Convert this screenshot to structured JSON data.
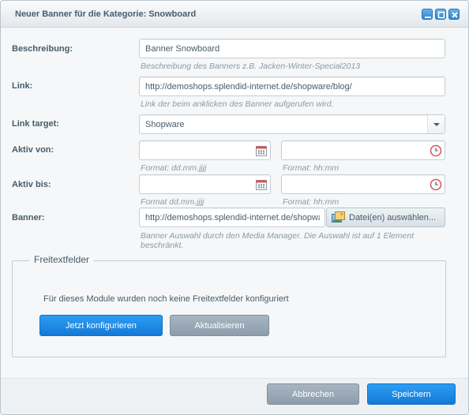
{
  "window": {
    "title": "Neuer Banner für die Kategorie: Snowboard",
    "controls": {
      "minimize": "minimize-icon",
      "maximize": "maximize-icon",
      "close": "close-icon"
    }
  },
  "form": {
    "beschreibung": {
      "label": "Beschreibung:",
      "value": "Banner Snowboard",
      "hint": "Beschreibung des Banners z.B. Jacken-Winter-Special2013"
    },
    "link": {
      "label": "Link:",
      "value": "http://demoshops.splendid-internet.de/shopware/blog/",
      "hint": "Link der beim anklicken des Banner aufgerufen wird."
    },
    "link_target": {
      "label": "Link target:",
      "value": "Shopware"
    },
    "aktiv_von": {
      "label": "Aktiv von:",
      "date_value": "",
      "date_hint": "Format: dd.mm.jjjj",
      "time_value": "",
      "time_hint": "Format: hh:mm"
    },
    "aktiv_bis": {
      "label": "Aktiv bis:",
      "date_value": "",
      "date_hint": "Format dd.mm.jjjj",
      "time_value": "",
      "time_hint": "Format: hh:mm"
    },
    "banner": {
      "label": "Banner:",
      "value": "http://demoshops.splendid-internet.de/shopware",
      "button_label": "Datei(en) auswählen...",
      "hint": "Banner Auswahl durch den Media Manager. Die Auswahl ist auf 1 Element beschränkt."
    }
  },
  "freitext": {
    "legend": "Freitextfelder",
    "message": "Für dieses Module wurden noch keine Freitextfelder konfiguriert",
    "configure_label": "Jetzt konfigurieren",
    "refresh_label": "Aktualisieren"
  },
  "footer": {
    "cancel_label": "Abbrechen",
    "save_label": "Speichern"
  },
  "colors": {
    "accent": "#1f8ae3",
    "secondary_button": "#97a8b5",
    "text": "#475c6a",
    "hint": "#8a9ba6"
  }
}
